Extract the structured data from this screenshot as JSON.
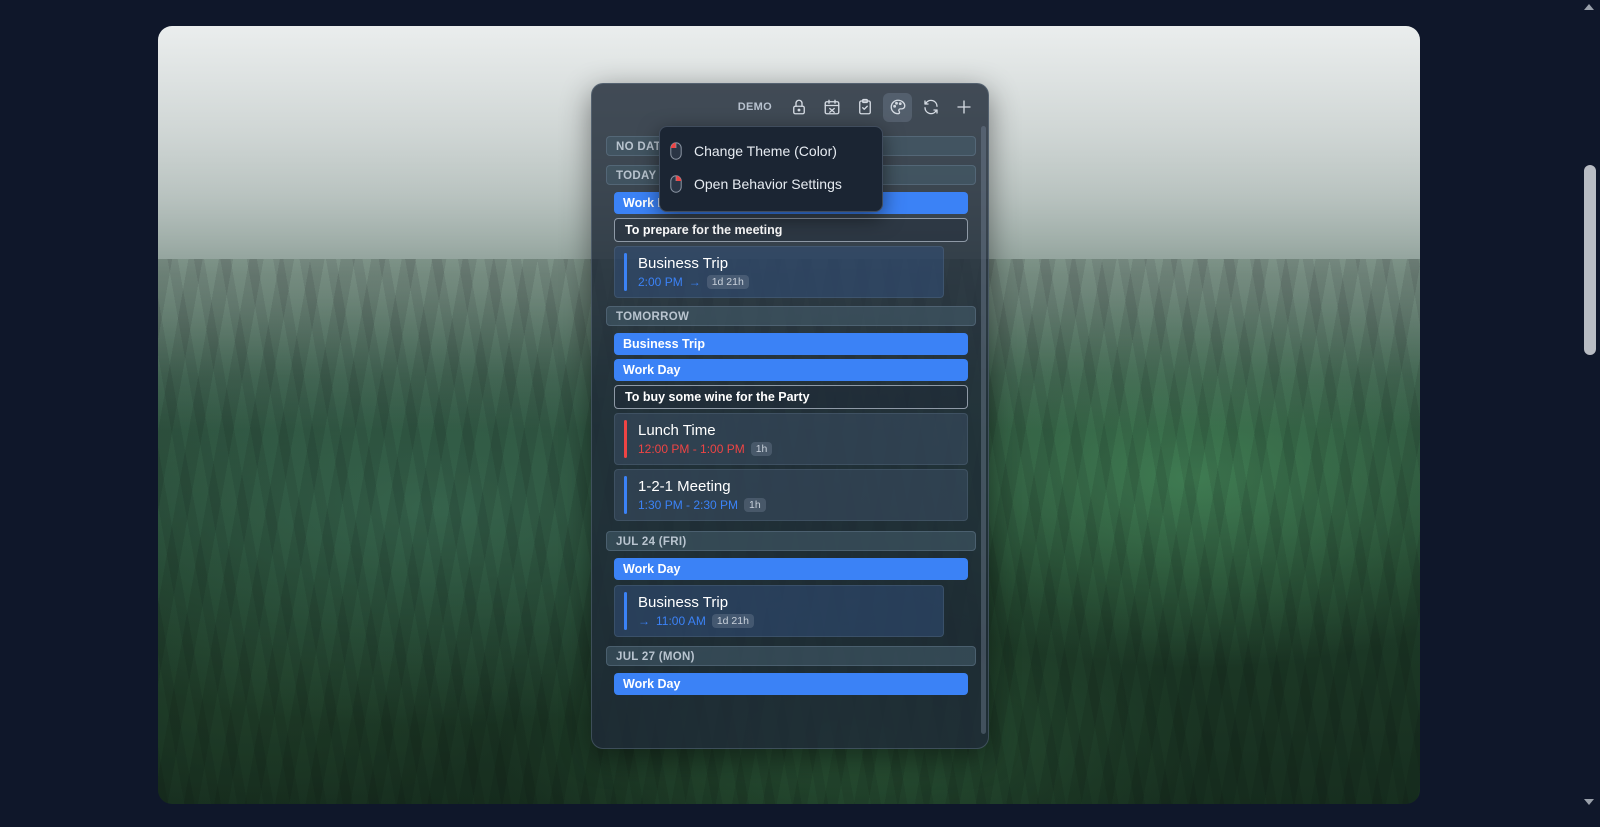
{
  "toolbar": {
    "mode_label": "DEMO",
    "buttons": [
      {
        "icon": "lock-icon"
      },
      {
        "icon": "calendar-off-icon"
      },
      {
        "icon": "clipboard-check-icon"
      },
      {
        "icon": "palette-icon",
        "active": true
      },
      {
        "icon": "refresh-icon"
      },
      {
        "icon": "plus-icon"
      }
    ]
  },
  "context_menu": {
    "items": [
      {
        "label": "Change Theme (Color)",
        "icon": "mouse-left-click-icon"
      },
      {
        "label": "Open Behavior Settings",
        "icon": "mouse-right-click-icon"
      }
    ]
  },
  "sections": {
    "no_date": "NO DATE",
    "today": "TODAY",
    "tomorrow": "TOMORROW",
    "jul24": "JUL 24 (FRI)",
    "jul27": "JUL 27 (MON)"
  },
  "today": {
    "allday_1": "Work Day",
    "task_1": "To prepare for the meeting",
    "event_1": {
      "title": "Business Trip",
      "start": "2:00 PM",
      "arrow": "→",
      "duration": "1d 21h"
    }
  },
  "tomorrow": {
    "allday_1": "Business Trip",
    "allday_2": "Work Day",
    "task_1": "To buy some wine for the Party",
    "event_1": {
      "title": "Lunch Time",
      "time": "12:00 PM - 1:00 PM",
      "duration": "1h",
      "color": "#ef4444"
    },
    "event_2": {
      "title": "1-2-1 Meeting",
      "time": "1:30 PM - 2:30 PM",
      "duration": "1h",
      "color": "#3b82f6"
    }
  },
  "jul24": {
    "allday_1": "Work Day",
    "event_1": {
      "title": "Business Trip",
      "arrow": "→",
      "end": "11:00 AM",
      "duration": "1d 21h"
    }
  },
  "jul27": {
    "allday_1": "Work Day"
  },
  "colors": {
    "accent": "#3b82f6",
    "danger": "#ef4444",
    "panel": "#1e2937"
  }
}
